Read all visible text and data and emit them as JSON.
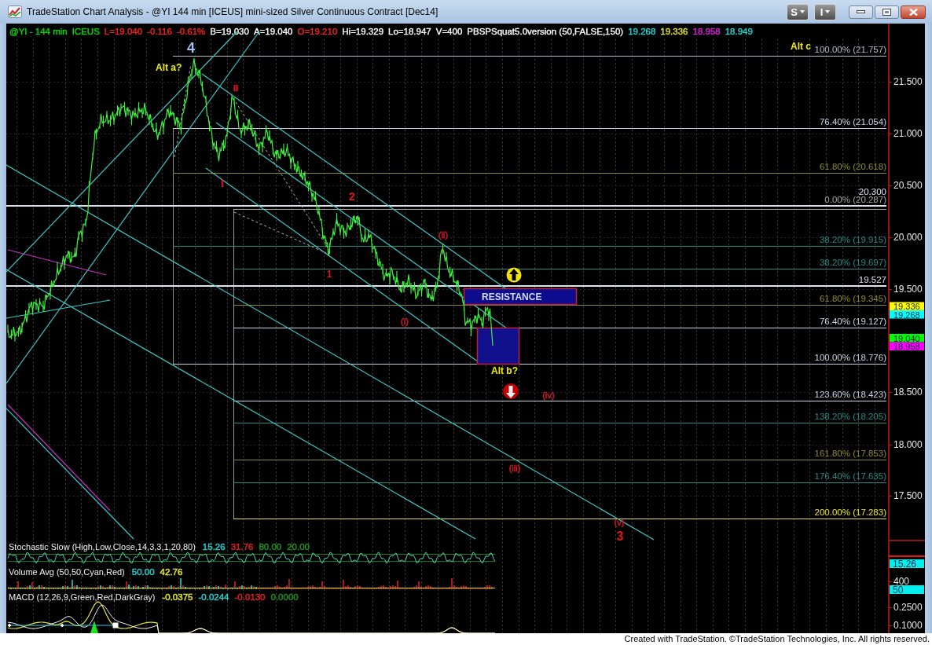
{
  "window": {
    "title": "TradeStation Chart Analysis - @YI 144 min [ICEUS] mini-sized Silver Continuous Contract [Dec14]",
    "toolbar_buttons": [
      "S",
      "I"
    ]
  },
  "chart_header": [
    {
      "text": "@YI - 144 min",
      "color": "#00dd00"
    },
    {
      "text": "ICEUS",
      "color": "#00dd00"
    },
    {
      "text": "L=19.040",
      "color": "#ff2020"
    },
    {
      "text": "-0.116",
      "color": "#ff2020"
    },
    {
      "text": "-0.61%",
      "color": "#ff2020"
    },
    {
      "text": "B=19.030",
      "color": "#ffffff"
    },
    {
      "text": "A=19.040",
      "color": "#ffffff"
    },
    {
      "text": "O=19.210",
      "color": "#ff2020"
    },
    {
      "text": "Hi=19.329",
      "color": "#ffffff"
    },
    {
      "text": "Lo=18.947",
      "color": "#ffffff"
    },
    {
      "text": "V=400",
      "color": "#ffffff"
    },
    {
      "text": "PBSPSquat5.0version (50,FALSE,150)",
      "color": "#ffffff"
    },
    {
      "text": "19.268",
      "color": "#20d8d8"
    },
    {
      "text": "19.336",
      "color": "#e8e820"
    },
    {
      "text": "18.958",
      "color": "#e020e0"
    },
    {
      "text": "18.949",
      "color": "#20d8d8"
    }
  ],
  "levels": [
    {
      "kind": "fibonacci",
      "label": "100.00% (21.757)",
      "color": "#b4bcc4"
    },
    {
      "kind": "fibonacci",
      "label": "76.40% (21.054)",
      "color": "#c4d4e4"
    },
    {
      "kind": "fibonacci",
      "label": "61.80% (20.618)",
      "color": "#8a8a34"
    },
    {
      "kind": "price_line",
      "label": "20.300",
      "color": "#dce4f0"
    },
    {
      "kind": "fibonacci",
      "label": "0.00% (20.287)",
      "color": "#a8a8a8"
    },
    {
      "kind": "fibonacci",
      "label": "38.20% (19.915)",
      "color": "#2a8a80"
    },
    {
      "kind": "fibonacci",
      "label": "38.20% (19.697)",
      "color": "#2a8a80"
    },
    {
      "kind": "price_line",
      "label": "19.527",
      "color": "#dce4f0"
    },
    {
      "kind": "fibonacci",
      "label": "61.80% (19.345)",
      "color": "#8a8a34"
    },
    {
      "kind": "fibonacci",
      "label": "76.40% (19.127)",
      "color": "#c4d4e4"
    },
    {
      "kind": "fibonacci",
      "label": "100.00% (18.776)",
      "color": "#c4d4e4"
    },
    {
      "kind": "fibonacci",
      "label": "123.60% (18.423)",
      "color": "#c4d4e4"
    },
    {
      "kind": "fibonacci",
      "label": "138.20% (18.205)",
      "color": "#2a8a80"
    },
    {
      "kind": "fibonacci",
      "label": "161.80% (17.853)",
      "color": "#8a8a34"
    },
    {
      "kind": "fibonacci",
      "label": "176.40% (17.635)",
      "color": "#2a8a80"
    },
    {
      "kind": "fibonacci",
      "label": "200.00% (17.283)",
      "color": "#e4e43c"
    }
  ],
  "annotations": [
    {
      "text": "4",
      "color": "#a0c4f0"
    },
    {
      "text": "Alt a?",
      "color": "#f0f000"
    },
    {
      "text": "ii",
      "color": "#d01828"
    },
    {
      "text": "i",
      "color": "#d01828"
    },
    {
      "text": "2",
      "color": "#e01818"
    },
    {
      "text": "1",
      "color": "#e01818"
    },
    {
      "text": "(ii)",
      "color": "#d01828"
    },
    {
      "text": "(i)",
      "color": "#d01828"
    },
    {
      "text": "Alt b?",
      "color": "#f0f000"
    },
    {
      "text": "(iv)",
      "color": "#d01828"
    },
    {
      "text": "(iii)",
      "color": "#d01828"
    },
    {
      "text": "(v)",
      "color": "#d01828"
    },
    {
      "text": "3",
      "color": "#e01818"
    },
    {
      "text": "Alt c",
      "color": "#f0f000"
    }
  ],
  "resistance_zone": {
    "label": "RESISTANCE"
  },
  "price_axis": {
    "ticks": [
      "21.500",
      "21.000",
      "20.500",
      "20.000",
      "19.500",
      "18.500",
      "18.000",
      "17.500"
    ],
    "tags": [
      {
        "text": "19.336",
        "color": "#ffff00"
      },
      {
        "text": "19.268",
        "color": "#00ffff"
      },
      {
        "text": "19.040",
        "color": "#00ff00"
      },
      {
        "text": "18.958",
        "color": "#ff00ff"
      }
    ]
  },
  "indicators": [
    {
      "kind": "stochastic",
      "label": "Stochastic Slow (High,Low,Close,14,3,3,1,20,80)",
      "values": [
        {
          "text": "15.26",
          "color": "#20d0d0"
        },
        {
          "text": "31.76",
          "color": "#e02020"
        },
        {
          "text": "80.00",
          "color": "#20901e"
        },
        {
          "text": "20.00",
          "color": "#20901e"
        }
      ]
    },
    {
      "kind": "volume",
      "label": "Volume Avg (50,50,Cyan,Red)",
      "values": [
        {
          "text": "50.00",
          "color": "#20d0d0"
        },
        {
          "text": "42.76",
          "color": "#e8e820"
        }
      ]
    },
    {
      "kind": "macd",
      "label": "MACD (12,26,9,Green,Red,DarkGray)",
      "values": [
        {
          "text": "-0.0375",
          "color": "#e8e820"
        },
        {
          "text": "-0.0244",
          "color": "#20d0d0"
        },
        {
          "text": "-0.0130",
          "color": "#e02020"
        },
        {
          "text": "0.0000",
          "color": "#20901e"
        }
      ]
    }
  ],
  "indicator_axis": [
    {
      "kind": "tag",
      "text": "15.26"
    },
    {
      "kind": "tick",
      "text": "400"
    },
    {
      "kind": "tag",
      "text": "50"
    },
    {
      "kind": "tick",
      "text": "0.2500"
    },
    {
      "kind": "tick",
      "text": "0.1000"
    }
  ],
  "footer": "Created with TradeStation. ©TradeStation Technologies, Inc. All rights reserved."
}
